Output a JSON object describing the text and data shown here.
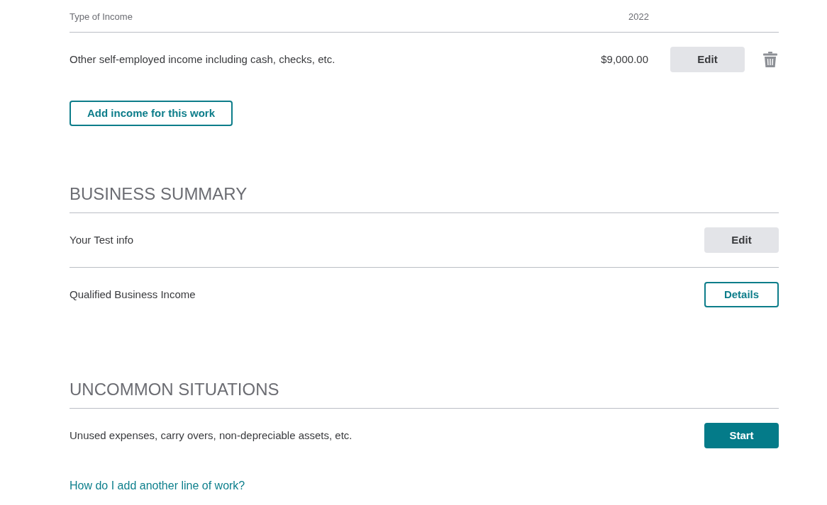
{
  "income_table": {
    "columns": [
      "Type of Income",
      "2022"
    ],
    "rows": [
      {
        "type": "Other self-employed income including cash, checks, etc.",
        "amount": "$9,000.00",
        "button": {
          "label": "Edit",
          "kind": "secondary"
        }
      }
    ]
  },
  "add_income_button": {
    "label": "Add income for this work",
    "kind": "outline"
  },
  "sections": [
    {
      "heading": "BUSINESS SUMMARY",
      "rows": [
        {
          "label": "Your Test info",
          "button": {
            "label": "Edit",
            "kind": "secondary"
          }
        },
        {
          "label": "Qualified Business Income",
          "button": {
            "label": "Details",
            "kind": "outline"
          }
        }
      ]
    },
    {
      "heading": "UNCOMMON SITUATIONS",
      "rows": [
        {
          "label": "Unused expenses, carry overs, non-depreciable assets, etc.",
          "button": {
            "label": "Start",
            "kind": "primary"
          }
        }
      ]
    }
  ],
  "help_link": "How do I add another line of work?"
}
